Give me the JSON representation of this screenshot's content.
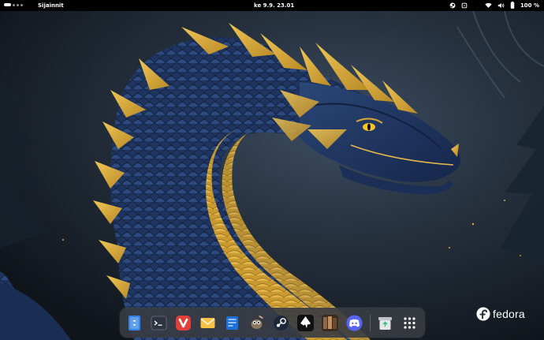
{
  "topbar": {
    "app_menu": "Sijainnit",
    "clock": "ke 9.9.  23.01",
    "battery_percent": "100 %",
    "icons": [
      "steam-tray-icon",
      "notification-icon",
      "wifi-icon",
      "volume-icon",
      "battery-icon"
    ]
  },
  "dock": {
    "items": [
      {
        "name": "files",
        "icon": "files-icon"
      },
      {
        "name": "terminal",
        "icon": "terminal-icon"
      },
      {
        "name": "vivaldi",
        "icon": "vivaldi-icon"
      },
      {
        "name": "mail",
        "icon": "mail-icon"
      },
      {
        "name": "software",
        "icon": "software-icon"
      },
      {
        "name": "gimp",
        "icon": "gimp-icon"
      },
      {
        "name": "steam",
        "icon": "steam-icon"
      },
      {
        "name": "inkscape",
        "icon": "inkscape-icon"
      },
      {
        "name": "game",
        "icon": "game-icon"
      },
      {
        "name": "discord",
        "icon": "discord-icon"
      },
      {
        "name": "trash",
        "icon": "trash-icon"
      },
      {
        "name": "show-apps",
        "icon": "app-grid-icon"
      }
    ]
  },
  "branding": {
    "logo_text": "fedora"
  },
  "colors": {
    "dragon_blue": "#1f3560",
    "dragon_gold": "#d2a437",
    "panel": "#000000",
    "dock": "#383c42",
    "vivaldi": "#e23f3b",
    "discord": "#5865f2"
  }
}
